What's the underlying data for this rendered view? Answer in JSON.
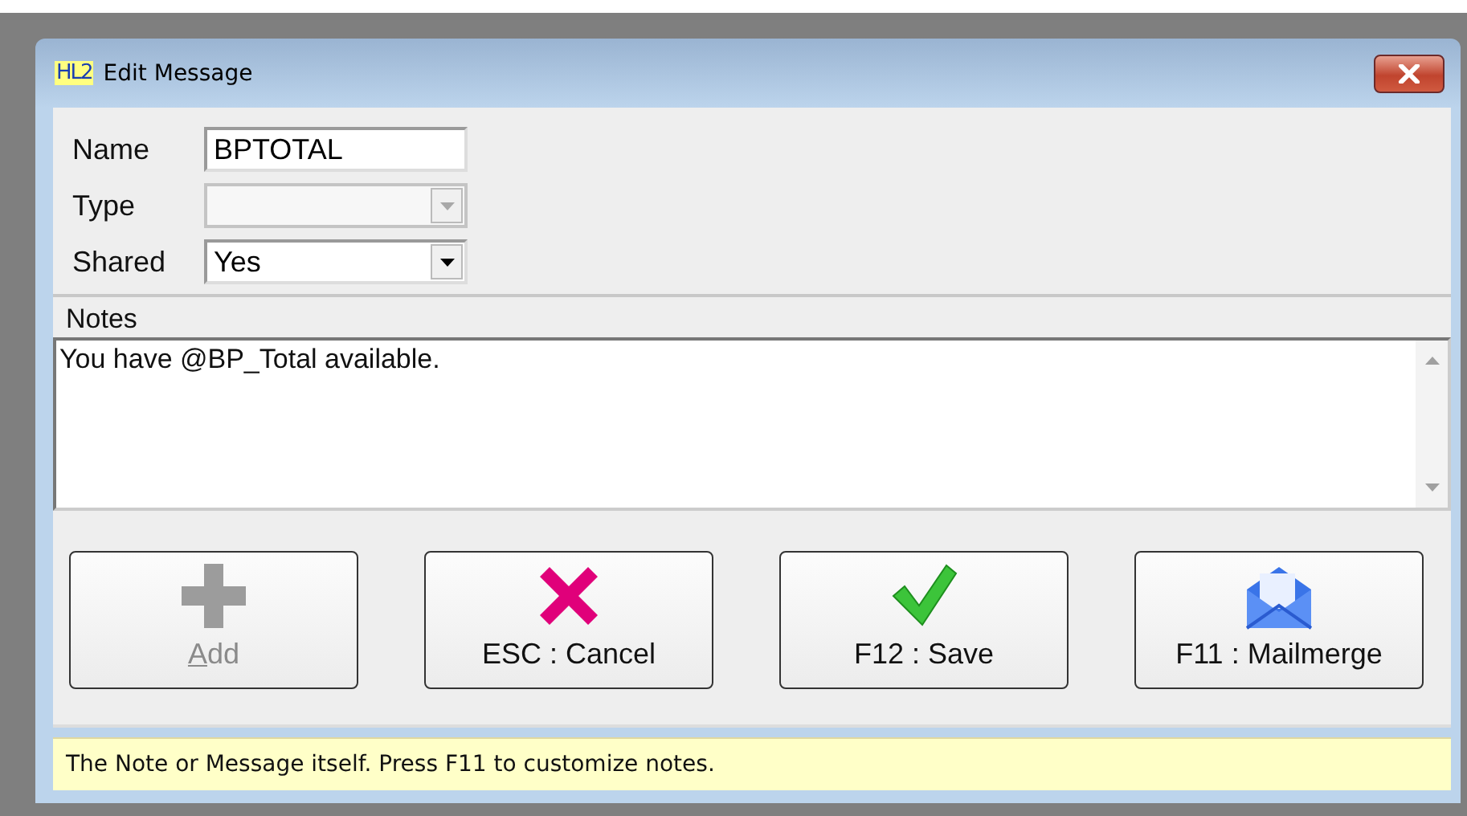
{
  "window": {
    "title": "Edit Message",
    "logo": "HL2"
  },
  "fields": [
    {
      "label": "Name",
      "kind": "text",
      "value": "BPTOTAL",
      "disabled": false
    },
    {
      "label": "Type",
      "kind": "dropdown",
      "disabled": true
    },
    {
      "label": "Shared",
      "kind": "dropdown",
      "value": "Yes",
      "disabled": false
    }
  ],
  "notes": {
    "label": "Notes",
    "value": "You have @BP_Total available."
  },
  "buttons": [
    {
      "label": "Add",
      "kind": "add",
      "disabled": true,
      "underline_first": true
    },
    {
      "label": "ESC : Cancel",
      "kind": "cancel",
      "disabled": false,
      "underline_first": false
    },
    {
      "label": "F12 : Save",
      "kind": "save",
      "disabled": false,
      "underline_first": false
    },
    {
      "label": "F11 : Mailmerge",
      "kind": "mailmerge",
      "disabled": false,
      "underline_first": false
    }
  ],
  "status_bar": "The Note or Message itself. Press F11 to customize notes."
}
